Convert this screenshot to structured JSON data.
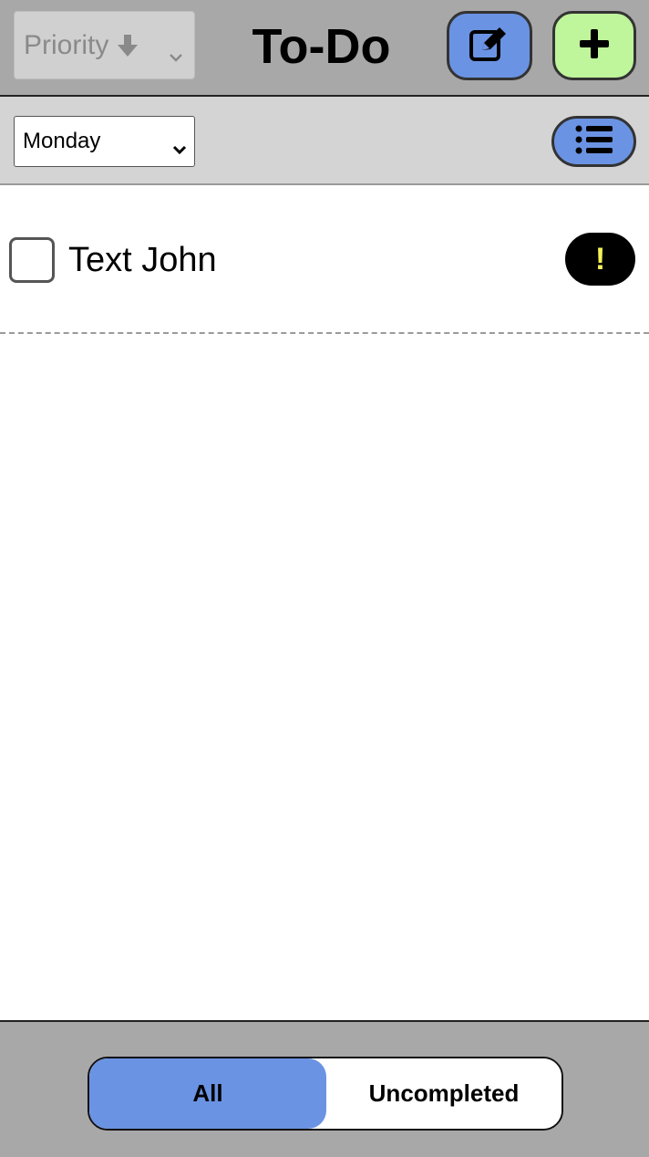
{
  "header": {
    "title": "To-Do",
    "sort_select": {
      "value": "Priority",
      "icon": "arrow-down-icon"
    },
    "edit_button": {
      "icon": "edit-icon",
      "color": "#6b93e3"
    },
    "add_button": {
      "icon": "plus-icon",
      "color": "#bff59b"
    }
  },
  "toolbar": {
    "day_select": {
      "value": "Monday"
    },
    "list_button": {
      "icon": "list-icon",
      "color": "#6b93e3"
    }
  },
  "tasks": [
    {
      "label": "Text John",
      "completed": false,
      "priority_badge": "!"
    }
  ],
  "footer": {
    "filters": [
      {
        "label": "All",
        "selected": true
      },
      {
        "label": "Uncompleted",
        "selected": false
      }
    ],
    "accent_color": "#6b93e3"
  }
}
